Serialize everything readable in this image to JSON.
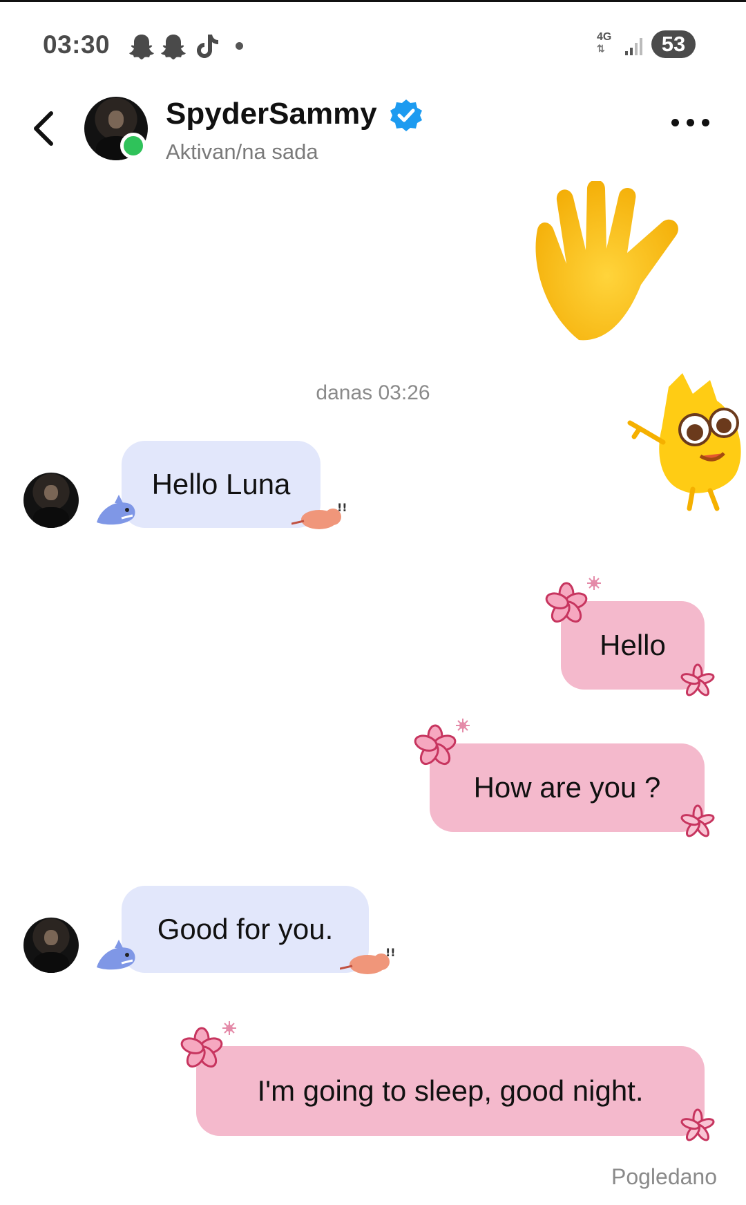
{
  "status_bar": {
    "time": "03:30",
    "network": "4G",
    "battery": "53",
    "icons": [
      "snapchat-icon",
      "snapchat-icon",
      "tiktok-icon",
      "notification-dot",
      "signal-icon",
      "battery-icon"
    ]
  },
  "header": {
    "contact_name": "SpyderSammy",
    "status": "Aktivan/na sada",
    "verified": true
  },
  "chat": {
    "timestamp": "danas 03:26",
    "messages": [
      {
        "side": "incoming",
        "text": "Hello Luna"
      },
      {
        "side": "outgoing",
        "text": "Hello"
      },
      {
        "side": "outgoing",
        "text": "How are you ?"
      },
      {
        "side": "incoming",
        "text": "Good for you."
      },
      {
        "side": "outgoing",
        "text": "I'm going to sleep, good night."
      }
    ],
    "seen_label": "Pogledano"
  },
  "colors": {
    "incoming_bubble": "#e2e7fb",
    "outgoing_bubble": "#f4b9cc",
    "online_dot": "#2fc25a",
    "verified_badge": "#1d9bf0",
    "flower": "#d0456f"
  }
}
